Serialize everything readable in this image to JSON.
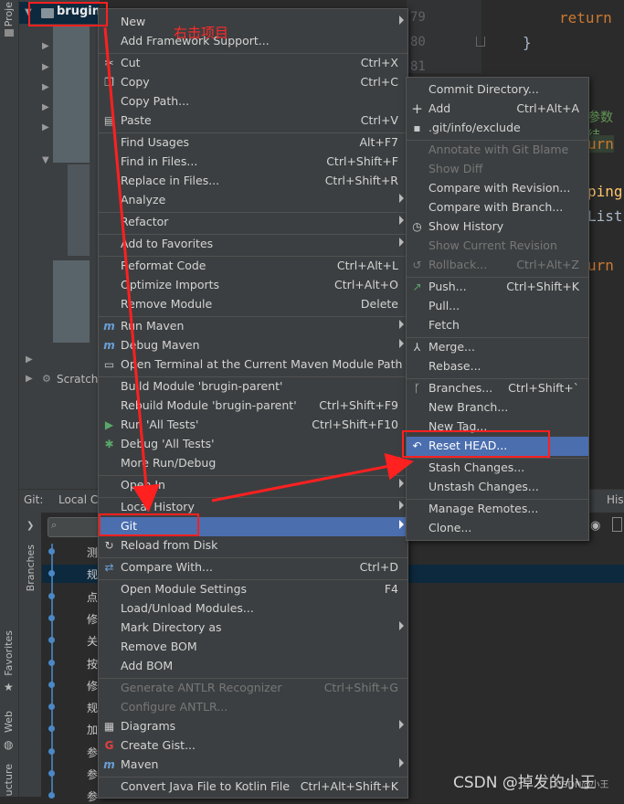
{
  "project": {
    "root_label": "brugin-",
    "scratches_label": "Scratche",
    "tool_tab": "Proje"
  },
  "editor": {
    "line_numbers": [
      "79",
      "80",
      "81"
    ],
    "code_return": "return",
    "code_brace": "}",
    "fragment_comment": "参数结",
    "fragment_urn1": "urn",
    "fragment_ping": "ping",
    "fragment_list": "List",
    "fragment_urn2": "urn"
  },
  "git_panel": {
    "tab_git": "Git:",
    "tab_local": "Local C",
    "tab_right": "His",
    "branches_label": "Branches",
    "log_entries": [
      "测",
      "规",
      "点",
      "修",
      "关",
      "按",
      "修",
      "规",
      "加",
      "参",
      "参",
      "参"
    ]
  },
  "left_tabs": {
    "favorites": "Favorites",
    "web": "Web",
    "structure": "ucture"
  },
  "annotation": {
    "text": "右击项目"
  },
  "context_menu": {
    "new": "New",
    "add_framework": "Add Framework Support...",
    "cut": "Cut",
    "cut_sc": "Ctrl+X",
    "copy": "Copy",
    "copy_sc": "Ctrl+C",
    "copy_path": "Copy Path...",
    "paste": "Paste",
    "paste_sc": "Ctrl+V",
    "find_usages": "Find Usages",
    "find_usages_sc": "Alt+F7",
    "find_in_files": "Find in Files...",
    "find_in_files_sc": "Ctrl+Shift+F",
    "replace_in_files": "Replace in Files...",
    "replace_in_files_sc": "Ctrl+Shift+R",
    "analyze": "Analyze",
    "refactor": "Refactor",
    "add_favorites": "Add to Favorites",
    "reformat": "Reformat Code",
    "reformat_sc": "Ctrl+Alt+L",
    "optimize": "Optimize Imports",
    "optimize_sc": "Ctrl+Alt+O",
    "remove_module": "Remove Module",
    "remove_module_sc": "Delete",
    "run_maven": "Run Maven",
    "debug_maven": "Debug Maven",
    "open_terminal": "Open Terminal at the Current Maven Module Path",
    "build_module": "Build Module 'brugin-parent'",
    "rebuild_module": "Rebuild Module 'brugin-parent'",
    "rebuild_module_sc": "Ctrl+Shift+F9",
    "run_tests": "Run 'All Tests'",
    "run_tests_sc": "Ctrl+Shift+F10",
    "debug_tests": "Debug 'All Tests'",
    "more_run": "More Run/Debug",
    "open_in": "Open In",
    "local_history": "Local History",
    "git": "Git",
    "reload": "Reload from Disk",
    "compare_with": "Compare With...",
    "compare_with_sc": "Ctrl+D",
    "module_settings": "Open Module Settings",
    "module_settings_sc": "F4",
    "load_unload": "Load/Unload Modules...",
    "mark_dir": "Mark Directory as",
    "remove_bom": "Remove BOM",
    "add_bom": "Add BOM",
    "antlr_gen": "Generate ANTLR Recognizer",
    "antlr_gen_sc": "Ctrl+Shift+G",
    "antlr_conf": "Configure ANTLR...",
    "diagrams": "Diagrams",
    "create_gist": "Create Gist...",
    "maven": "Maven",
    "convert_kotlin": "Convert Java File to Kotlin File",
    "convert_kotlin_sc": "Ctrl+Alt+Shift+K"
  },
  "git_submenu": {
    "commit_dir": "Commit Directory...",
    "add": "Add",
    "add_sc": "Ctrl+Alt+A",
    "exclude": ".git/info/exclude",
    "annotate": "Annotate with Git Blame",
    "show_diff": "Show Diff",
    "compare_revision": "Compare with Revision...",
    "compare_branch": "Compare with Branch...",
    "show_history": "Show History",
    "show_current_rev": "Show Current Revision",
    "rollback": "Rollback...",
    "rollback_sc": "Ctrl+Alt+Z",
    "push": "Push...",
    "push_sc": "Ctrl+Shift+K",
    "pull": "Pull...",
    "fetch": "Fetch",
    "merge": "Merge...",
    "rebase": "Rebase...",
    "branches": "Branches...",
    "branches_sc": "Ctrl+Shift+`",
    "new_branch": "New Branch...",
    "new_tag": "New Tag...",
    "reset_head": "Reset HEAD...",
    "stash": "Stash Changes...",
    "unstash": "Unstash Changes...",
    "manage_remotes": "Manage Remotes...",
    "clone": "Clone..."
  },
  "watermark": {
    "text": "CSDN @掉发的小王",
    "small": "CSDN@小王"
  },
  "colors": {
    "menu_bg": "#3c3f41",
    "highlight": "#4b6eaf",
    "annotation_red": "#ff2020"
  }
}
